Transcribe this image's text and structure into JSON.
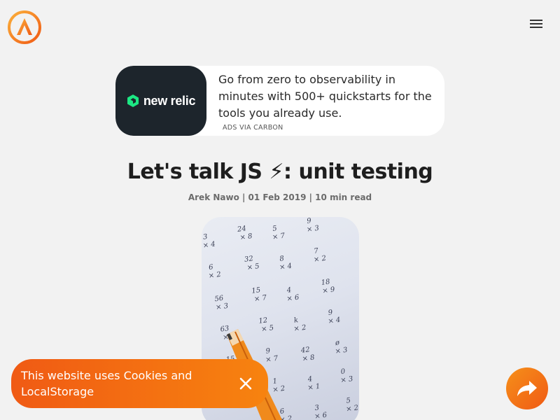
{
  "header": {
    "logo_icon": "site-logo-icon",
    "menu_icon": "hamburger-menu-icon"
  },
  "ad": {
    "brand": "new relic",
    "text": "Go from zero to observability in minutes with 500+ quickstarts for the tools you already use.",
    "via": "ADS VIA CARBON"
  },
  "article": {
    "title": "Let's talk JS ⚡: unit testing",
    "meta": "Arek Nawo | 01 Feb 2019 | 10 min read"
  },
  "cookie": {
    "text": "This website uses Cookies and LocalStorage",
    "close_icon": "close-icon"
  },
  "share": {
    "icon": "share-arrow-icon"
  },
  "colors": {
    "accent": "#f47a12",
    "ad_logo_bg": "#1d252c",
    "new_relic_green": "#1ce783"
  }
}
